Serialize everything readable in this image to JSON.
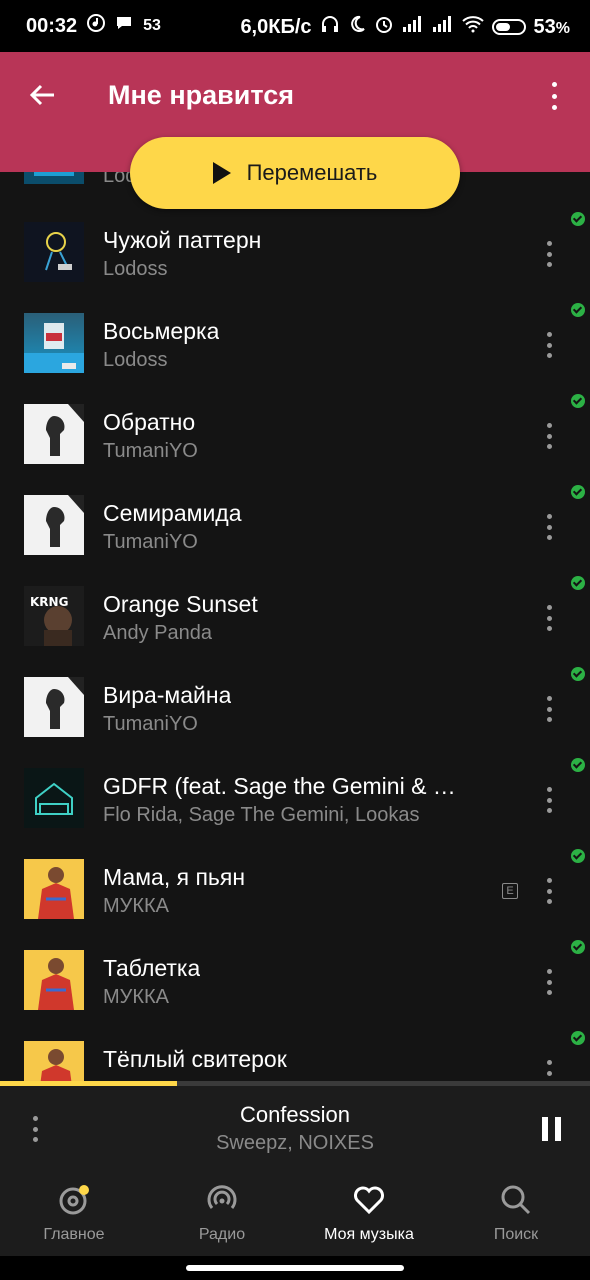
{
  "status_bar": {
    "time": "00:32",
    "notif_count": "53",
    "speed": "6,0КБ/с",
    "battery": "53",
    "battery_unit": "%"
  },
  "header": {
    "title": "Мне нравится",
    "shuffle_label": "Перемешать"
  },
  "partial_row": {
    "artist": "Lodoss"
  },
  "tracks": [
    {
      "title": "Чужой паттерн",
      "artist": "Lodoss",
      "downloaded": true,
      "explicit": false
    },
    {
      "title": "Восьмерка",
      "artist": "Lodoss",
      "downloaded": true,
      "explicit": false
    },
    {
      "title": "Обратно",
      "artist": "TumaniYO",
      "downloaded": true,
      "explicit": false
    },
    {
      "title": "Семирамида",
      "artist": "TumaniYO",
      "downloaded": true,
      "explicit": false
    },
    {
      "title": "Orange Sunset",
      "artist": "Andy Panda",
      "downloaded": true,
      "explicit": false
    },
    {
      "title": "Вира-майна",
      "artist": "TumaniYO",
      "downloaded": true,
      "explicit": false
    },
    {
      "title": "GDFR (feat. Sage the Gemini & …",
      "artist": "Flo Rida, Sage The Gemini, Lookas",
      "downloaded": true,
      "explicit": false
    },
    {
      "title": "Мама, я пьян",
      "artist": "МУККА",
      "downloaded": true,
      "explicit": true,
      "explicit_label": "E"
    },
    {
      "title": "Таблетка",
      "artist": "МУККА",
      "downloaded": true,
      "explicit": false
    },
    {
      "title": "Тёплый свитерок",
      "artist": "",
      "downloaded": true,
      "explicit": false
    }
  ],
  "player": {
    "title": "Confession",
    "artist": "Sweepz, NOIXES",
    "progress": 0.3
  },
  "nav": {
    "items": [
      {
        "label": "Главное",
        "icon": "home-disc-icon",
        "active": false
      },
      {
        "label": "Радио",
        "icon": "radio-icon",
        "active": false
      },
      {
        "label": "Моя музыка",
        "icon": "heart-icon",
        "active": true
      },
      {
        "label": "Поиск",
        "icon": "search-icon",
        "active": false
      }
    ]
  },
  "colors": {
    "header": "#b83557",
    "accent": "#fed749",
    "downloaded": "#2cb145",
    "list_bg": "#141414"
  }
}
